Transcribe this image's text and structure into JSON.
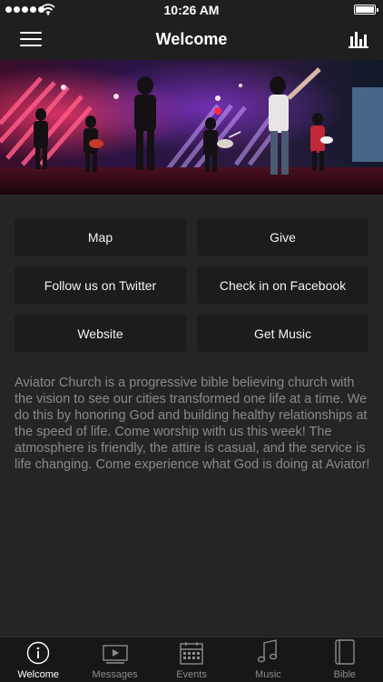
{
  "status_bar": {
    "time": "10:26 AM",
    "signal_bars": 5,
    "battery_level": 1.0
  },
  "nav": {
    "title": "Welcome",
    "menu_icon": "hamburger-icon",
    "right_icon": "bar-chart-icon"
  },
  "hero": {
    "image": "worship-band-on-stage-photo"
  },
  "buttons": [
    {
      "label": "Map"
    },
    {
      "label": "Give"
    },
    {
      "label": "Follow us on Twitter"
    },
    {
      "label": "Check in on Facebook"
    },
    {
      "label": "Website"
    },
    {
      "label": "Get Music"
    }
  ],
  "description": "Aviator Church is a progressive bible believing church with the vision to see our cities transformed one life at a time. We do this by honoring God and building healthy relationships at the speed of life. Come worship with us this week! The atmosphere is friendly, the attire is casual, and the service is life changing. Come experience what God is doing at Aviator!",
  "tabs": [
    {
      "label": "Welcome",
      "icon": "info-circle-icon",
      "active": true
    },
    {
      "label": "Messages",
      "icon": "video-icon",
      "active": false
    },
    {
      "label": "Events",
      "icon": "calendar-icon",
      "active": false
    },
    {
      "label": "Music",
      "icon": "music-note-icon",
      "active": false
    },
    {
      "label": "Bible",
      "icon": "book-icon",
      "active": false
    }
  ],
  "colors": {
    "background": "#252525",
    "bar": "#1f1f1f",
    "tile": "#1c1c1c",
    "body_text": "#8a8a8a",
    "tab_active": "#ffffff",
    "tab_inactive": "#8c8c8c"
  }
}
